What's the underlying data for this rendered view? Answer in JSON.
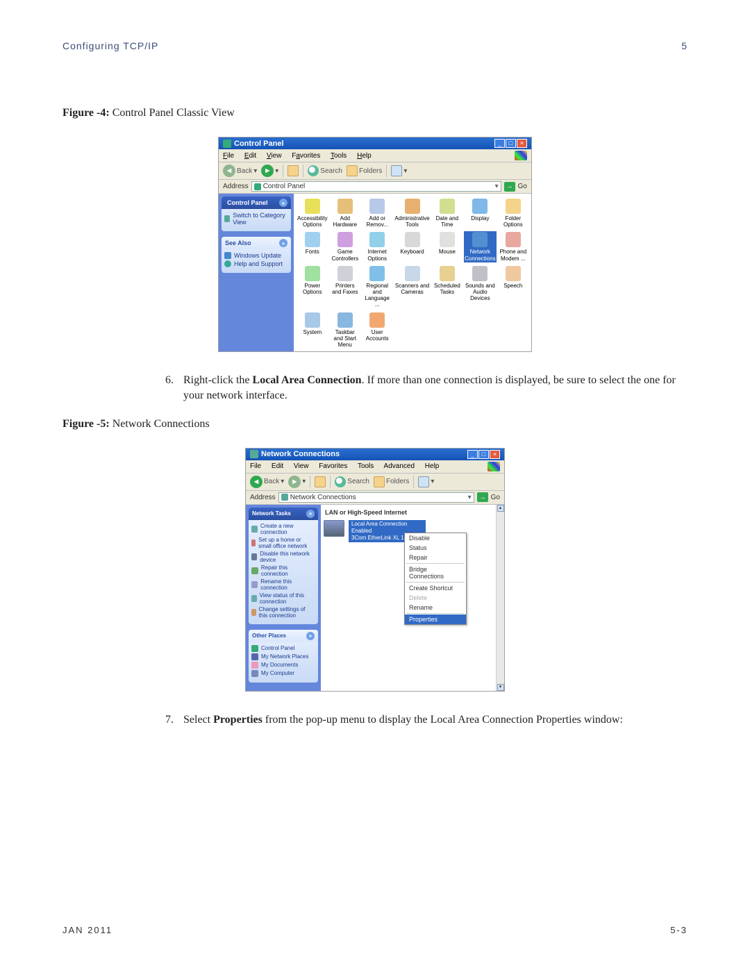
{
  "page": {
    "header_left": "Configuring TCP/IP",
    "header_right": "5",
    "footer_left": "JAN 2011",
    "footer_right": "5-3"
  },
  "fig4": {
    "label": "Figure -4:",
    "caption": " Control Panel Classic View",
    "title": "Control Panel",
    "menus": {
      "file": "File",
      "edit": "Edit",
      "view": "View",
      "fav": "Favorites",
      "tools": "Tools",
      "help": "Help"
    },
    "toolbar": {
      "back": "Back",
      "search": "Search",
      "folders": "Folders"
    },
    "address_label": "Address",
    "address_value": "Control Panel",
    "go": "Go",
    "side": {
      "panel_title": "Control Panel",
      "switch": "Switch to Category View",
      "see_also": "See Also",
      "win_upd": "Windows Update",
      "help": "Help and Support"
    },
    "icons": [
      "Accessibility Options",
      "Add Hardware",
      "Add or Remov...",
      "Administrative Tools",
      "Date and Time",
      "Display",
      "Folder Options",
      "Fonts",
      "Game Controllers",
      "Internet Options",
      "Keyboard",
      "Mouse",
      "Network Connections",
      "Phone and Modem ...",
      "Power Options",
      "Printers and Faxes",
      "Regional and Language ...",
      "Scanners and Cameras",
      "Scheduled Tasks",
      "Sounds and Audio Devices",
      "Speech",
      "System",
      "Taskbar and Start Menu",
      "User Accounts"
    ]
  },
  "step6": {
    "num": "6.",
    "pre": "Right-click the ",
    "bold": "Local Area Connection",
    "post": ". If more than one connection is displayed, be sure to select the one for your network interface."
  },
  "fig5": {
    "label": "Figure -5:",
    "caption": " Network Connections",
    "title": "Network Connections",
    "menus": {
      "file": "File",
      "edit": "Edit",
      "view": "View",
      "fav": "Favorites",
      "tools": "Tools",
      "adv": "Advanced",
      "help": "Help"
    },
    "toolbar": {
      "back": "Back",
      "search": "Search",
      "folders": "Folders"
    },
    "address_label": "Address",
    "address_value": "Network Connections",
    "go": "Go",
    "tasks": {
      "hdr": "Network Tasks",
      "items": [
        "Create a new connection",
        "Set up a home or small office network",
        "Disable this network device",
        "Repair this connection",
        "Rename this connection",
        "View status of this connection",
        "Change settings of this connection"
      ]
    },
    "places": {
      "hdr": "Other Places",
      "items": [
        "Control Panel",
        "My Network Places",
        "My Documents",
        "My Computer"
      ]
    },
    "cat": "LAN or High-Speed Internet",
    "item": {
      "name": "Local Area Connection",
      "status": "Enabled",
      "dev": "3Com EtherLink XL 10/100 P"
    },
    "ctx": [
      "Disable",
      "Status",
      "Repair",
      "Bridge Connections",
      "Create Shortcut",
      "Delete",
      "Rename",
      "Properties"
    ]
  },
  "step7": {
    "num": "7.",
    "pre": "Select ",
    "bold": "Properties",
    "post": " from the pop-up menu to display the Local Area Connection Properties window:"
  }
}
